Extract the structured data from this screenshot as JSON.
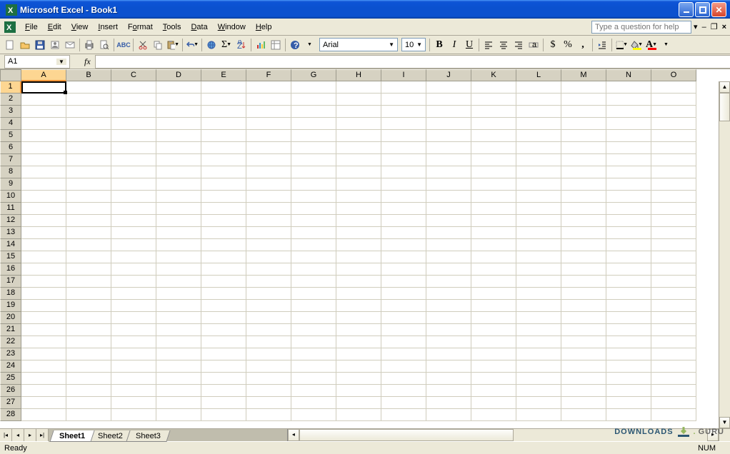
{
  "title": "Microsoft Excel - Book1",
  "menu": {
    "items": [
      {
        "label": "File",
        "ukey": "F"
      },
      {
        "label": "Edit",
        "ukey": "E"
      },
      {
        "label": "View",
        "ukey": "V"
      },
      {
        "label": "Insert",
        "ukey": "I"
      },
      {
        "label": "Format",
        "ukey": "o"
      },
      {
        "label": "Tools",
        "ukey": "T"
      },
      {
        "label": "Data",
        "ukey": "D"
      },
      {
        "label": "Window",
        "ukey": "W"
      },
      {
        "label": "Help",
        "ukey": "H"
      }
    ],
    "help_placeholder": "Type a question for help"
  },
  "toolbar": {
    "font_name": "Arial",
    "font_size": "10",
    "currency_symbol": "$",
    "percent_symbol": "%",
    "comma_symbol": ","
  },
  "formula": {
    "name_box": "A1",
    "fx_label": "fx",
    "value": ""
  },
  "grid": {
    "columns": [
      "A",
      "B",
      "C",
      "D",
      "E",
      "F",
      "G",
      "H",
      "I",
      "J",
      "K",
      "L",
      "M",
      "N",
      "O"
    ],
    "rows": [
      1,
      2,
      3,
      4,
      5,
      6,
      7,
      8,
      9,
      10,
      11,
      12,
      13,
      14,
      15,
      16,
      17,
      18,
      19,
      20,
      21,
      22,
      23,
      24,
      25,
      26,
      27,
      28
    ],
    "active_cell": {
      "row": 1,
      "col": "A"
    }
  },
  "sheets": {
    "tabs": [
      "Sheet1",
      "Sheet2",
      "Sheet3"
    ],
    "active": 0
  },
  "status": {
    "ready": "Ready",
    "num": "NUM"
  },
  "watermark": {
    "brand": "DOWNLOADS",
    "suffix": "GURU"
  }
}
